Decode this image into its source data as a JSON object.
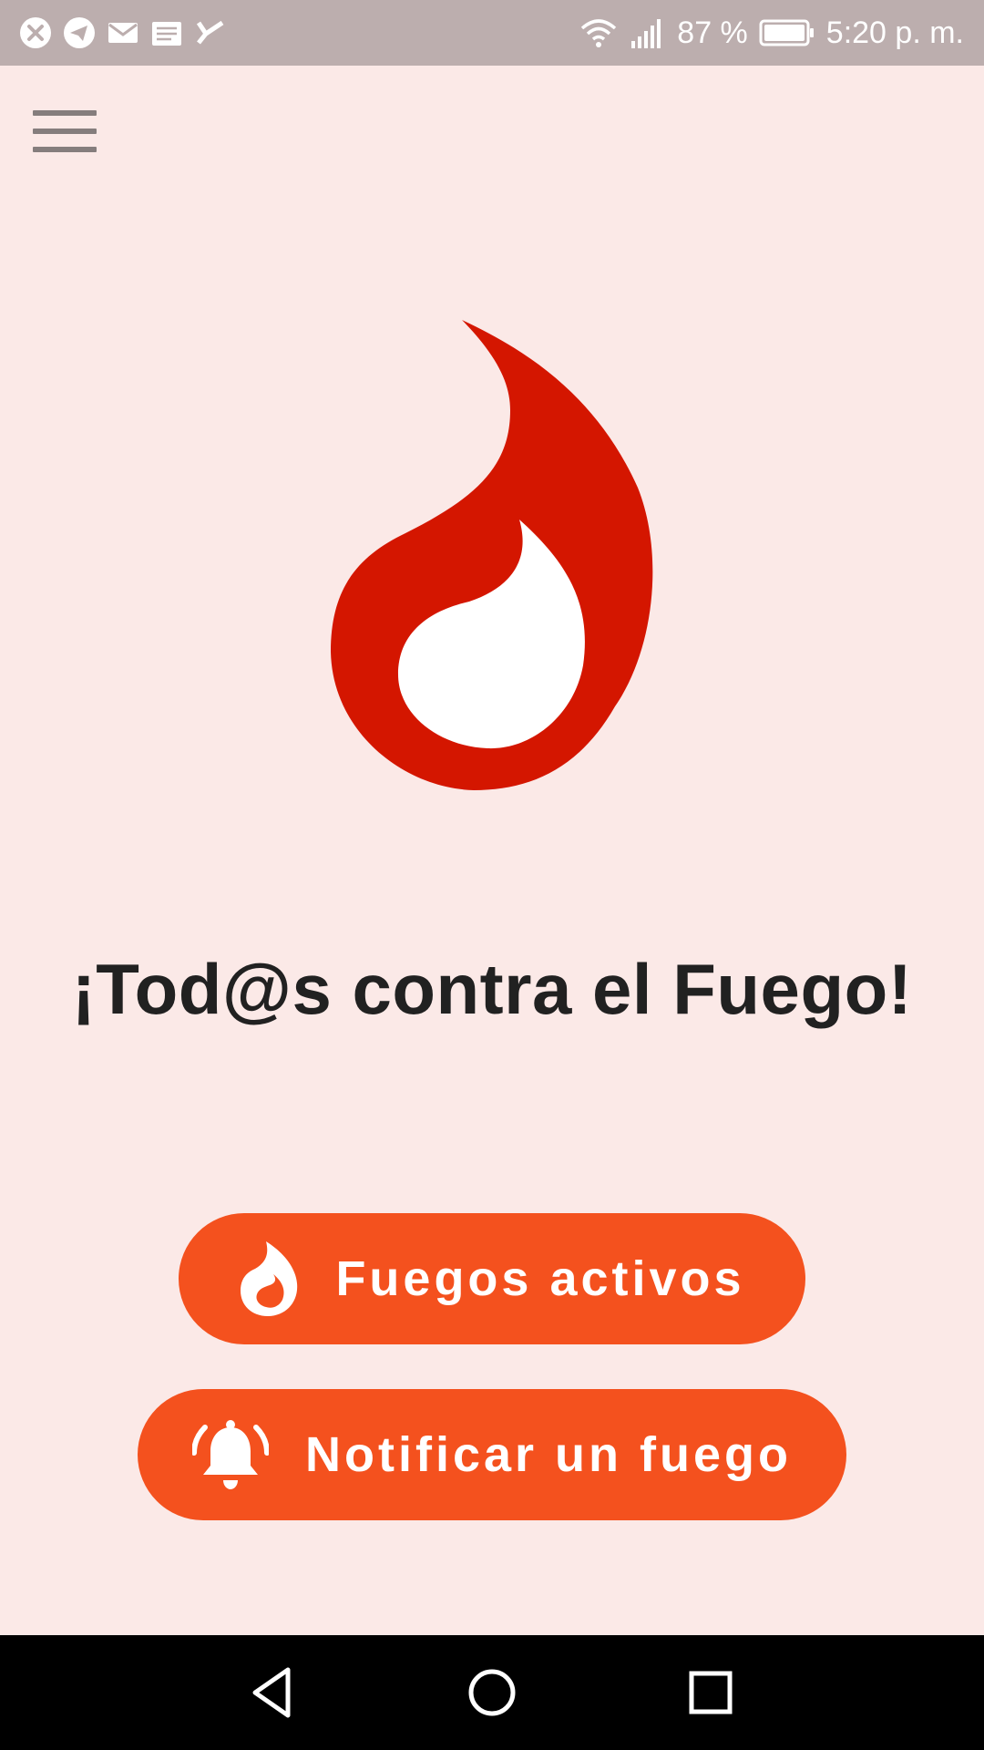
{
  "status_bar": {
    "battery": "87 %",
    "time": "5:20 p. m.",
    "notification_icons": [
      "x-circle-icon",
      "telegram-icon",
      "mail-icon",
      "news-icon",
      "check-icon"
    ],
    "system_icons": [
      "wifi-icon",
      "signal-icon",
      "battery-icon"
    ]
  },
  "app_bar": {
    "menu_icon": "hamburger-menu-icon"
  },
  "logo": {
    "icon": "flame-icon",
    "colors": {
      "outer": "#d41600",
      "inner": "#ffffff"
    }
  },
  "main": {
    "title": "¡Tod@s contra el Fuego!"
  },
  "buttons": {
    "active_fires": {
      "label": "Fuegos activos",
      "icon": "flame-icon"
    },
    "report_fire": {
      "label": "Notificar un fuego",
      "icon": "bell-ringing-icon"
    }
  },
  "nav_bar": {
    "items": [
      "back-icon",
      "home-icon",
      "recents-icon"
    ]
  },
  "colors": {
    "background": "#fbe9e7",
    "status_bar": "#bcaeae",
    "accent": "#f4511e",
    "title_text": "#212121",
    "nav_bar": "#000000"
  }
}
